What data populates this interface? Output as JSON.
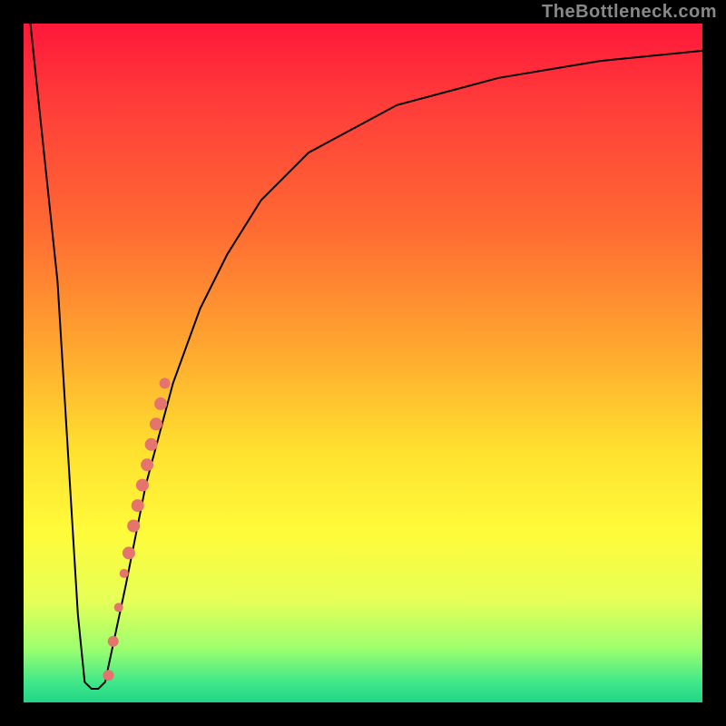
{
  "attribution": "TheBottleneck.com",
  "colors": {
    "frame": "#000000",
    "dot": "#e4746d",
    "curve": "#000000",
    "gradient_stops": [
      "#ff183a",
      "#ff3d3a",
      "#ff6a33",
      "#ffa82f",
      "#ffe12f",
      "#fffb3a",
      "#e6ff57",
      "#9eff6e",
      "#40e88a",
      "#22d487"
    ]
  },
  "chart_data": {
    "type": "line",
    "title": "",
    "xlabel": "",
    "ylabel": "",
    "xlim": [
      0,
      100
    ],
    "ylim": [
      0,
      100
    ],
    "series": [
      {
        "name": "bottleneck-curve",
        "x": [
          1,
          5,
          8,
          9,
          10,
          11,
          12,
          15,
          18,
          22,
          26,
          30,
          35,
          42,
          55,
          70,
          85,
          100
        ],
        "y": [
          100,
          62,
          13,
          3,
          2,
          2,
          3,
          17,
          32,
          47,
          58,
          66,
          74,
          81,
          88,
          92,
          94.5,
          96
        ]
      }
    ],
    "points": [
      {
        "x": 12.5,
        "y": 4,
        "r": 6
      },
      {
        "x": 13.2,
        "y": 9,
        "r": 6
      },
      {
        "x": 14.0,
        "y": 14,
        "r": 5
      },
      {
        "x": 14.8,
        "y": 19,
        "r": 5
      },
      {
        "x": 15.5,
        "y": 22,
        "r": 7
      },
      {
        "x": 16.2,
        "y": 26,
        "r": 7
      },
      {
        "x": 16.8,
        "y": 29,
        "r": 7
      },
      {
        "x": 17.5,
        "y": 32,
        "r": 7
      },
      {
        "x": 18.2,
        "y": 35,
        "r": 7
      },
      {
        "x": 18.8,
        "y": 38,
        "r": 7
      },
      {
        "x": 19.5,
        "y": 41,
        "r": 7
      },
      {
        "x": 20.2,
        "y": 44,
        "r": 7
      },
      {
        "x": 20.8,
        "y": 47,
        "r": 6
      }
    ]
  }
}
